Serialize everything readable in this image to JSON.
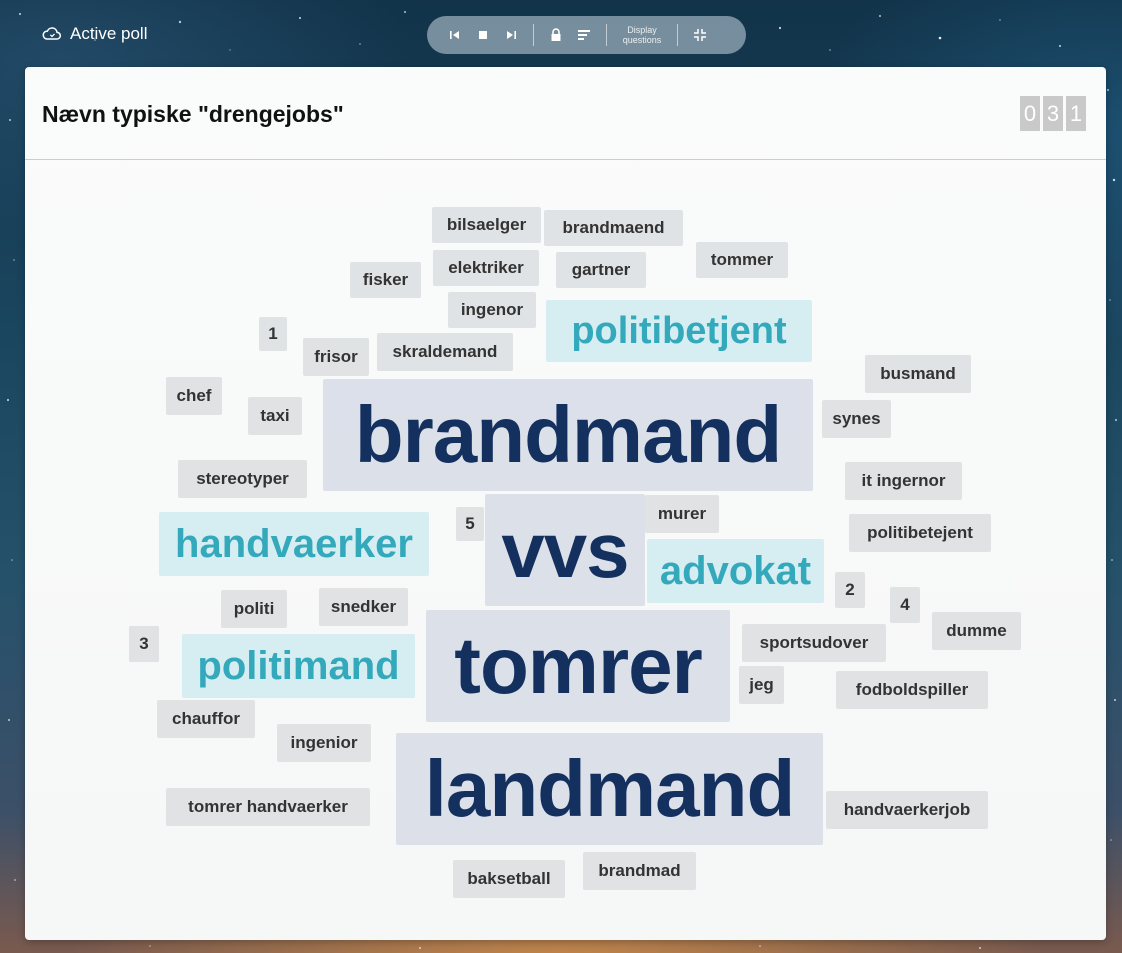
{
  "app": {
    "title": "Active poll"
  },
  "toolbar": {
    "display_questions_label": "Display questions"
  },
  "poll": {
    "question": "Nævn typiske \"drengejobs\"",
    "counter_digits": [
      "0",
      "3",
      "1"
    ]
  },
  "colors": {
    "teal": "#35a9bc",
    "navy": "#14305f",
    "small_word": "#333333",
    "counter_bg": "#c9c9c9"
  },
  "words": {
    "bilsaelger": "bilsaelger",
    "brandmaend": "brandmaend",
    "tommer": "tommer",
    "fisker": "fisker",
    "elektriker": "elektriker",
    "gartner": "gartner",
    "ingenor": "ingenor",
    "politibetjent": "politibetjent",
    "n1": "1",
    "frisor": "frisor",
    "skraldemand": "skraldemand",
    "busmand": "busmand",
    "chef": "chef",
    "taxi": "taxi",
    "brandmand": "brandmand",
    "synes": "synes",
    "stereotyper": "stereotyper",
    "it_ingernor": "it ingernor",
    "handvaerker": "handvaerker",
    "n5": "5",
    "vvs": "vvs",
    "murer": "murer",
    "politibetejent": "politibetejent",
    "advokat": "advokat",
    "n2": "2",
    "n4": "4",
    "politi": "politi",
    "snedker": "snedker",
    "dumme": "dumme",
    "n3": "3",
    "politimand": "politimand",
    "tomrer": "tomrer",
    "sportsudover": "sportsudover",
    "jeg": "jeg",
    "fodboldspiller": "fodboldspiller",
    "chauffor": "chauffor",
    "ingenior": "ingenior",
    "landmand": "landmand",
    "tomrer_handvaerker": "tomrer handvaerker",
    "handvaerkerjob": "handvaerkerjob",
    "baksetball": "baksetball",
    "brandmad": "brandmad"
  }
}
